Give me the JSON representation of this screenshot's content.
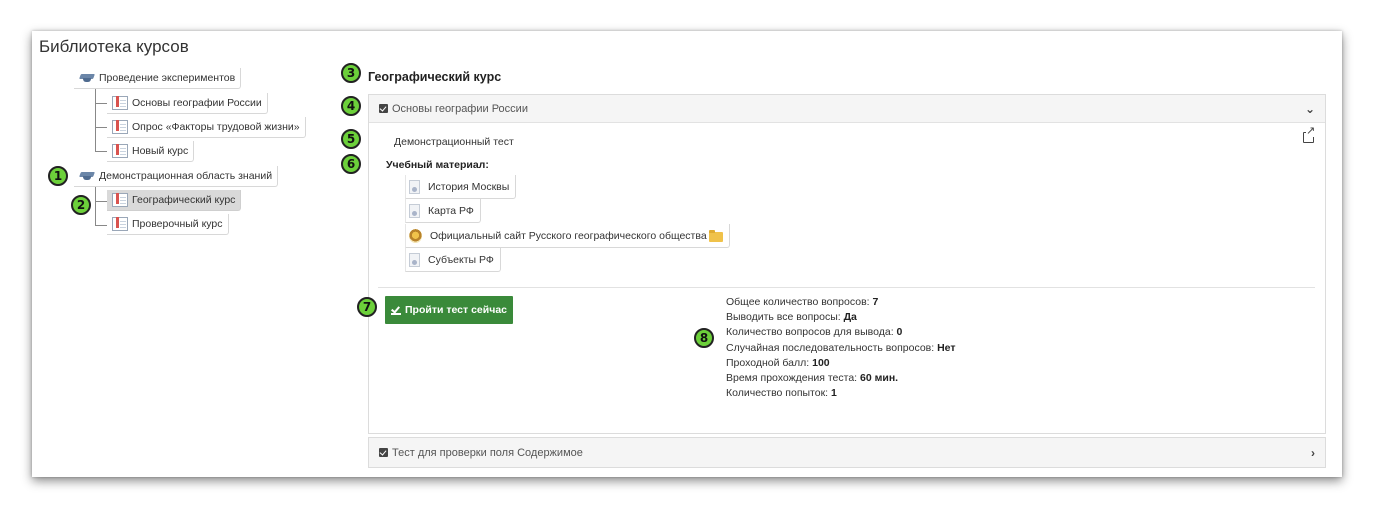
{
  "app": {
    "title": "Библиотека курсов"
  },
  "tree": {
    "nodes": [
      {
        "label": "Проведение экспериментов",
        "type": "area"
      },
      {
        "label": "Основы географии России",
        "type": "course"
      },
      {
        "label": "Опрос «Факторы трудовой жизни»",
        "type": "course"
      },
      {
        "label": "Новый курс",
        "type": "course"
      },
      {
        "label": "Демонстрационная область знаний",
        "type": "area"
      },
      {
        "label": "Географический курс",
        "type": "course",
        "selected": true
      },
      {
        "label": "Проверочный курс",
        "type": "course"
      }
    ]
  },
  "badges": [
    "1",
    "2",
    "3",
    "4",
    "5",
    "6",
    "7",
    "8"
  ],
  "main": {
    "course_title": "Географический курс",
    "panel1": {
      "title": "Основы географии России",
      "test_name": "Демонстрационный тест",
      "materials_label": "Учебный материал:",
      "materials": [
        "История Москвы",
        "Карта РФ",
        "Официальный сайт Русского географического общества",
        "Субъекты РФ"
      ],
      "button_label": "Пройти тест сейчас",
      "stats": [
        {
          "label": "Общее количество вопросов:",
          "value": "7"
        },
        {
          "label": "Выводить все вопросы:",
          "value": "Да"
        },
        {
          "label": "Количество вопросов для вывода:",
          "value": "0"
        },
        {
          "label": "Случайная последовательность вопросов:",
          "value": "Нет"
        },
        {
          "label": "Проходной балл:",
          "value": "100"
        },
        {
          "label": "Время прохождения теста:",
          "value": "60 мин."
        },
        {
          "label": "Количество попыток:",
          "value": "1"
        }
      ]
    },
    "panel2": {
      "title": "Тест для проверки поля Содержимое"
    }
  },
  "colors": {
    "badge": "#6cd03a",
    "button": "#3a8a3a",
    "selected_node": "#d9d9d9"
  }
}
